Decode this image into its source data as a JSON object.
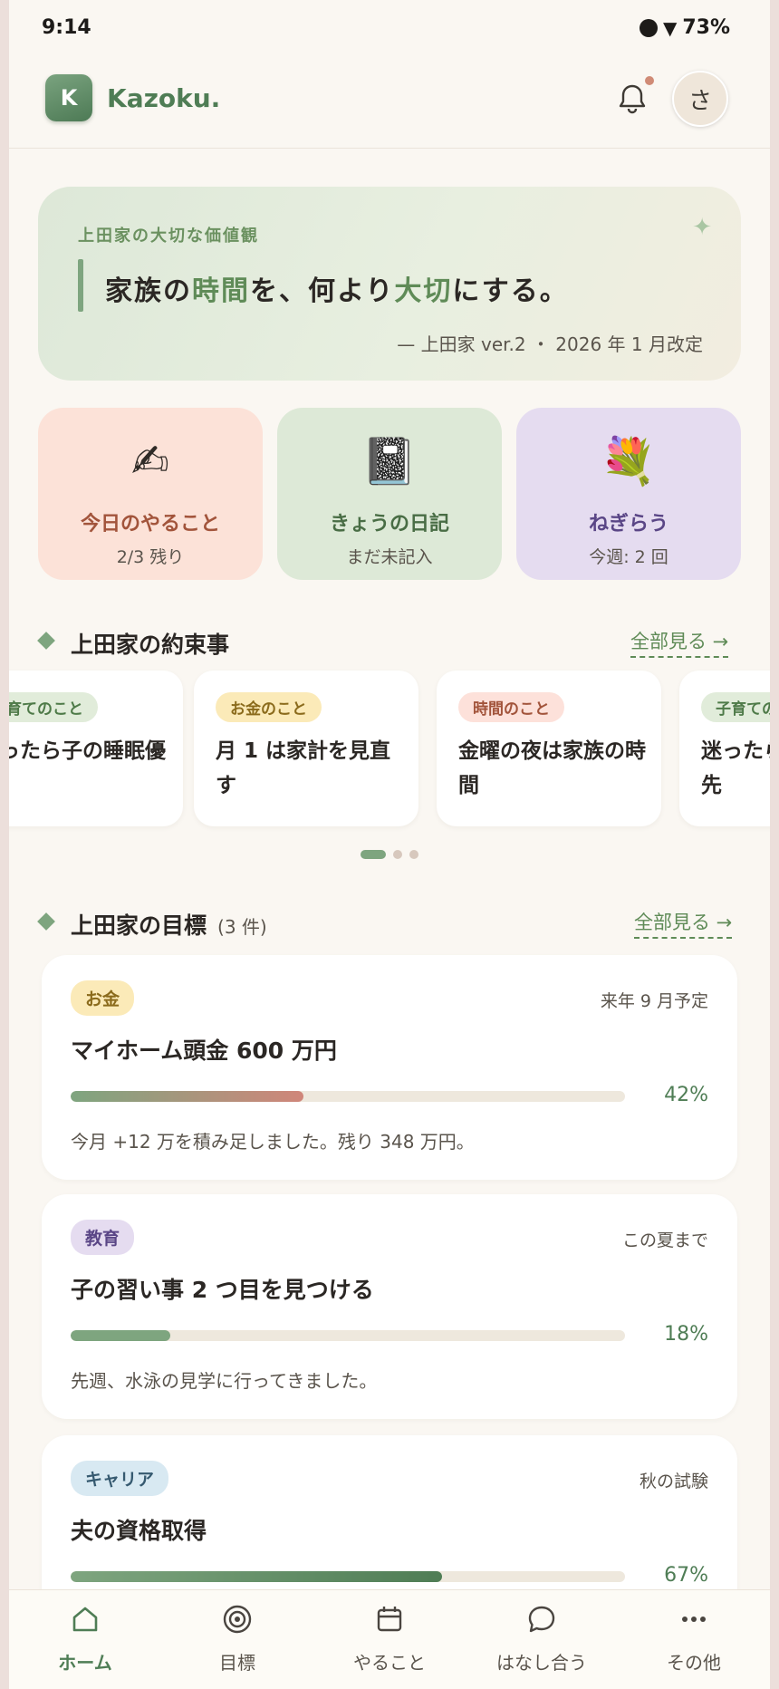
{
  "status_bar": {
    "time": "9:14",
    "battery": "73%"
  },
  "header": {
    "logo_letter": "K",
    "app_name": "Kazoku.",
    "avatar_initial": "さ"
  },
  "values_card": {
    "label": "上田家の大切な価値観",
    "quote_parts": [
      "家族の",
      "時間",
      "を、何より",
      "大切",
      "にする。"
    ],
    "signature": "— 上田家 ver.2 ・ 2026 年 1 月改定"
  },
  "quick_tiles": [
    {
      "icon": "✍",
      "title": "今日のやること",
      "sub": "2/3 残り"
    },
    {
      "icon": "📓",
      "title": "きょうの日記",
      "sub": "まだ未記入"
    },
    {
      "icon": "💐",
      "title": "ねぎらう",
      "sub": "今週: 2 回"
    }
  ],
  "rules_section": {
    "title": "上田家の約束事",
    "see_all": "全部見る →",
    "items": [
      {
        "tag": "子育てのこと",
        "text": "迷ったら子の睡眠優先"
      },
      {
        "tag": "お金のこと",
        "text": "月 1 は家計を見直す"
      },
      {
        "tag": "時間のこと",
        "text": "金曜の夜は家族の時間"
      },
      {
        "tag": "子育てのこと",
        "text": "迷ったら子の睡眠優先"
      }
    ]
  },
  "goals_section": {
    "title": "上田家の目標",
    "count": "(3 件)",
    "see_all": "全部見る →",
    "items": [
      {
        "tag": "お金",
        "due": "来年 9 月予定",
        "title": "マイホーム頭金 600 万円",
        "progress": 42,
        "pct": "42%",
        "note": "今月 +12 万を積み足しました。残り 348 万円。"
      },
      {
        "tag": "教育",
        "due": "この夏まで",
        "title": "子の習い事 2 つ目を見つける",
        "progress": 18,
        "pct": "18%",
        "note": "先週、水泳の見学に行ってきました。"
      },
      {
        "tag": "キャリア",
        "due": "秋の試験",
        "title": "夫の資格取得",
        "progress": 67,
        "pct": "67%",
        "note": ""
      }
    ]
  },
  "bottom_nav": [
    {
      "label": "ホーム",
      "icon": "home-icon",
      "active": true
    },
    {
      "label": "目標",
      "icon": "target-icon",
      "active": false
    },
    {
      "label": "やること",
      "icon": "calendar-icon",
      "active": false
    },
    {
      "label": "はなし合う",
      "icon": "chat-bubble-icon",
      "active": false
    },
    {
      "label": "その他",
      "icon": "more-icon",
      "active": false
    }
  ],
  "colors": {
    "brand_green": "#4f7d55",
    "accent_green": "#7ea57f",
    "notification_dot": "#d08b76"
  }
}
